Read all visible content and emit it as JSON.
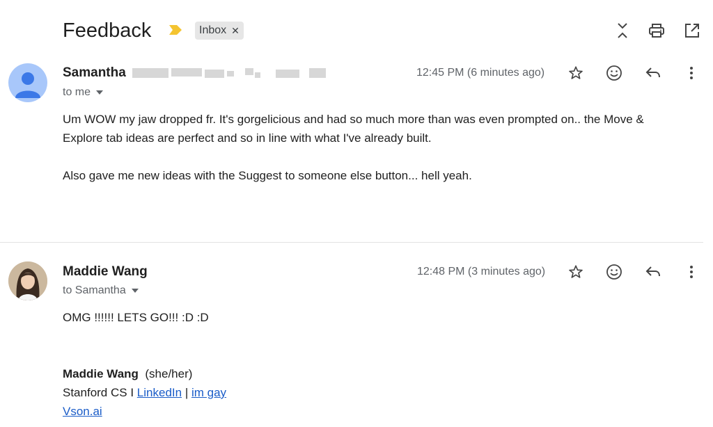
{
  "thread": {
    "subject": "Feedback",
    "label": "Inbox"
  },
  "messages": [
    {
      "sender": "Samantha",
      "recipient_line": "to me",
      "time": "12:45 PM (6 minutes ago)",
      "body": [
        "Um WOW my jaw dropped fr. It's gorgelicious and had so much more than was even prompted on.. the Move &",
        "Explore tab ideas are perfect and so in line with what I've already built.",
        "Also gave me new ideas with the Suggest to someone else button... hell yeah."
      ]
    },
    {
      "sender": "Maddie Wang",
      "recipient_line": "to Samantha",
      "time": "12:48 PM (3 minutes ago)",
      "body": [
        "OMG !!!!!! LETS GO!!! :D :D"
      ],
      "signature": {
        "name": "Maddie Wang",
        "pronouns": "(she/her)",
        "line2_prefix": "Stanford CS I",
        "link1": "LinkedIn",
        "separator": "|",
        "link2": "im gay",
        "website": "Vson.ai"
      }
    }
  ],
  "colors": {
    "importance_marker": "#f4c430",
    "avatar_default_bg": "#a8c7fa",
    "avatar_default_fg": "#3b78e7",
    "link": "#1a5cc8"
  },
  "icons": {
    "header": [
      "expand-collapse-icon",
      "print-icon",
      "open-in-new-window-icon"
    ],
    "message": [
      "star-icon",
      "emoji-react-icon",
      "reply-icon",
      "more-vert-icon"
    ]
  }
}
